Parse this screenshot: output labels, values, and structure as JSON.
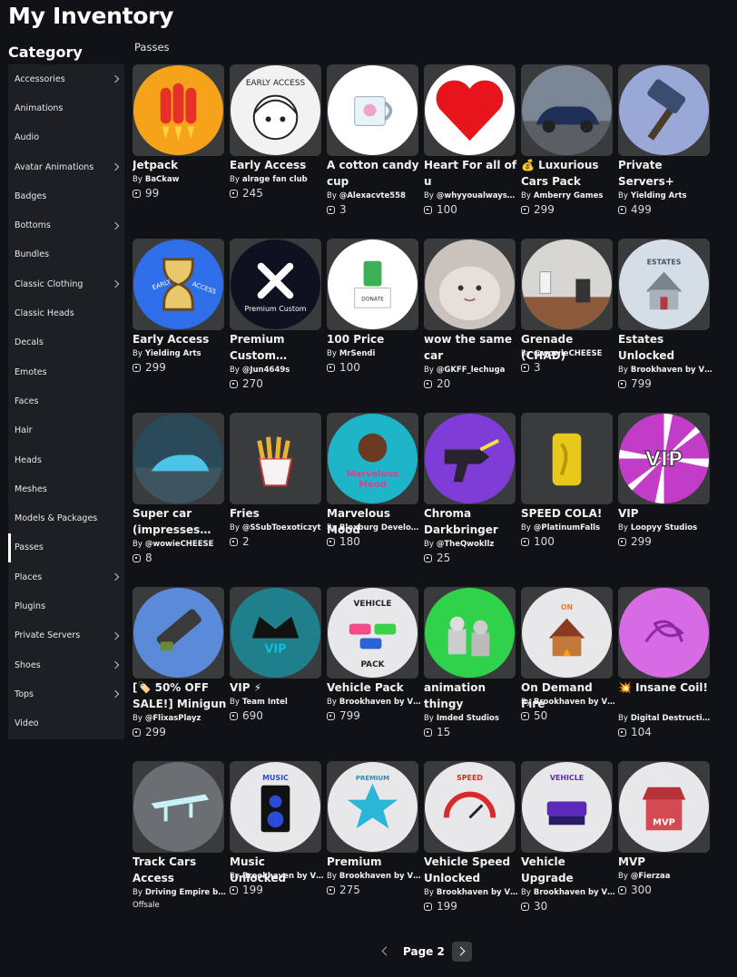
{
  "page": {
    "title": "My Inventory",
    "category_title": "Category",
    "section_title": "Passes"
  },
  "sidebar": {
    "items": [
      {
        "label": "Accessories",
        "chevron": true
      },
      {
        "label": "Animations",
        "chevron": false
      },
      {
        "label": "Audio",
        "chevron": false
      },
      {
        "label": "Avatar Animations",
        "chevron": true
      },
      {
        "label": "Badges",
        "chevron": false
      },
      {
        "label": "Bottoms",
        "chevron": true
      },
      {
        "label": "Bundles",
        "chevron": false
      },
      {
        "label": "Classic Clothing",
        "chevron": true
      },
      {
        "label": "Classic Heads",
        "chevron": false
      },
      {
        "label": "Decals",
        "chevron": false
      },
      {
        "label": "Emotes",
        "chevron": false
      },
      {
        "label": "Faces",
        "chevron": false
      },
      {
        "label": "Hair",
        "chevron": false
      },
      {
        "label": "Heads",
        "chevron": false
      },
      {
        "label": "Meshes",
        "chevron": false
      },
      {
        "label": "Models & Packages",
        "chevron": false
      },
      {
        "label": "Passes",
        "chevron": false,
        "active": true
      },
      {
        "label": "Places",
        "chevron": true
      },
      {
        "label": "Plugins",
        "chevron": false
      },
      {
        "label": "Private Servers",
        "chevron": true
      },
      {
        "label": "Shoes",
        "chevron": true
      },
      {
        "label": "Tops",
        "chevron": true
      },
      {
        "label": "Video",
        "chevron": false
      }
    ]
  },
  "items": [
    {
      "name": "Jetpack",
      "creator": "BaCkaw",
      "price": "99",
      "icon": "jetpack-icon",
      "bg": "#f6a21b"
    },
    {
      "name": "Early Access",
      "creator": "alrage fan club",
      "price": "245",
      "icon": "anime-girl-icon",
      "bg": "#f2f2f2"
    },
    {
      "name": "A cotton candy cup",
      "creator": "@Alexacvte558",
      "price": "3",
      "icon": "mug-icon",
      "bg": "#ffffff"
    },
    {
      "name": "Heart For all of u",
      "creator": "@whyyoualwaysr…",
      "price": "100",
      "icon": "heart-icon",
      "bg": "#ffffff"
    },
    {
      "name": "💰 Luxurious Cars Pack",
      "creator": "Amberry Games",
      "price": "299",
      "icon": "car-icon",
      "bg": "#7a8596"
    },
    {
      "name": "Private Servers+",
      "creator": "Yielding Arts",
      "price": "499",
      "icon": "hammer-icon",
      "bg": "#9aa8d8"
    },
    {
      "name": "Early Access",
      "creator": "Yielding Arts",
      "price": "299",
      "icon": "hourglass-icon",
      "bg": "#2e6ee8"
    },
    {
      "name": "Premium Custom Service",
      "creator": "@Jun4649s",
      "price": "270",
      "icon": "tools-icon",
      "bg": "#0e1220"
    },
    {
      "name": "100 Price",
      "creator": "MrSendi",
      "price": "100",
      "icon": "donate-box-icon",
      "bg": "#ffffff"
    },
    {
      "name": "wow the same car",
      "creator": "@GKFF_lechuga",
      "price": "20",
      "icon": "cat-photo-icon",
      "bg": "#c9c2bd"
    },
    {
      "name": "Grenade (CHAD)",
      "creator": "@wowieCHEESE",
      "price": "3",
      "icon": "room-scene-icon",
      "bg": "#d8d6d2"
    },
    {
      "name": "Estates Unlocked",
      "creator": "Brookhaven by V…",
      "price": "799",
      "icon": "estate-house-icon",
      "bg": "#d5dde6"
    },
    {
      "name": "Super car (impresses…",
      "creator": "@wowieCHEESE",
      "price": "8",
      "icon": "supercar-icon",
      "bg": "#2a4a5a"
    },
    {
      "name": "Fries",
      "creator": "@SSubToexoticzyt",
      "price": "2",
      "icon": "fries-icon",
      "bg": "#393b3d"
    },
    {
      "name": "Marvelous Mood",
      "creator": "Bloxburg Develo…",
      "price": "180",
      "icon": "marvelous-mood-icon",
      "bg": "#1fb5c9"
    },
    {
      "name": "Chroma Darkbringer",
      "creator": "@TheQwokllz",
      "price": "25",
      "icon": "chroma-gun-icon",
      "bg": "#7f3cd6"
    },
    {
      "name": "SPEED COLA!",
      "creator": "@PlatinumFalls",
      "price": "100",
      "icon": "soda-can-icon",
      "bg": "#393b3d"
    },
    {
      "name": "VIP",
      "creator": "Loopyy Studios",
      "price": "299",
      "icon": "vip-burst-icon",
      "bg": "#c23cc8"
    },
    {
      "name": "[🏷️ 50% OFF SALE!] Minigun",
      "creator": "@FlixasPlayz",
      "price": "299",
      "icon": "minigun-icon",
      "bg": "#5a8ad8"
    },
    {
      "name": "VIP ⚡",
      "creator": "Team Intel",
      "price": "690",
      "icon": "vip-crown-icon",
      "bg": "#1f7f8a"
    },
    {
      "name": "Vehicle Pack",
      "creator": "Brookhaven by V…",
      "price": "799",
      "icon": "vehicle-pack-icon",
      "bg": "#e8e8ea"
    },
    {
      "name": "animation thingy",
      "creator": "Imded Studios",
      "price": "15",
      "icon": "animation-scene-icon",
      "bg": "#2fd24a"
    },
    {
      "name": "On Demand Fire",
      "creator": "Brookhaven by V…",
      "price": "50",
      "icon": "on-demand-fire-icon",
      "bg": "#e8e8ea"
    },
    {
      "name": "💥 Insane Coil!",
      "creator": "Digital Destruction",
      "price": "104",
      "icon": "coil-icon",
      "bg": "#d66be4"
    },
    {
      "name": "Track Cars Access",
      "creator": "Driving Empire b…",
      "price": "",
      "offsale": "Offsale",
      "icon": "spoiler-icon",
      "bg": "#6b6e72"
    },
    {
      "name": "Music Unlocked",
      "creator": "Brookhaven by V…",
      "price": "199",
      "icon": "speaker-icon",
      "bg": "#e8e8ea"
    },
    {
      "name": "Premium",
      "creator": "Brookhaven by V…",
      "price": "275",
      "icon": "premium-star-icon",
      "bg": "#e8e8ea"
    },
    {
      "name": "Vehicle Speed Unlocked",
      "creator": "Brookhaven by V…",
      "price": "199",
      "icon": "speedometer-icon",
      "bg": "#e8e8ea"
    },
    {
      "name": "Vehicle Upgrade",
      "creator": "Brookhaven by V…",
      "price": "30",
      "icon": "vehicle-upgrade-icon",
      "bg": "#e8e8ea"
    },
    {
      "name": "MVP",
      "creator": "@Fierzaa",
      "price": "300",
      "icon": "mvp-building-icon",
      "bg": "#e8e8ea"
    }
  ],
  "pagination": {
    "label": "Page 2"
  },
  "by_label": "By"
}
